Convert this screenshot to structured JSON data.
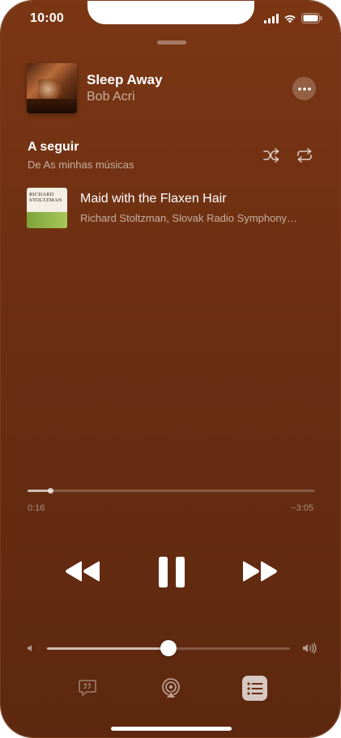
{
  "status_bar": {
    "time": "10:00",
    "icons": [
      "cellular-signal-icon",
      "wifi-icon",
      "battery-icon"
    ]
  },
  "now_playing": {
    "title": "Sleep Away",
    "artist": "Bob Acri",
    "more_icon": "ellipsis-icon"
  },
  "up_next": {
    "heading": "A seguir",
    "source": "De As minhas músicas",
    "shuffle_icon": "shuffle-icon",
    "repeat_icon": "repeat-icon",
    "items": [
      {
        "title": "Maid with the Flaxen Hair",
        "artist": "Richard Stoltzman, Slovak Radio Symphony…",
        "art_text": "RICHARD STOLTZMAN"
      }
    ]
  },
  "playback": {
    "elapsed": "0:16",
    "remaining": "−3:05",
    "progress_fraction": 0.08
  },
  "volume": {
    "level_fraction": 0.5
  },
  "controls": {
    "rewind_icon": "backward-icon",
    "pause_icon": "pause-icon",
    "forward_icon": "forward-icon"
  },
  "bottom_bar": {
    "lyrics_icon": "lyrics-icon",
    "airplay_icon": "airplay-icon",
    "queue_icon": "queue-list-icon"
  },
  "colors": {
    "background_top": "#7b3714",
    "background_bottom": "#5d280f",
    "accent": "#ffffff"
  }
}
